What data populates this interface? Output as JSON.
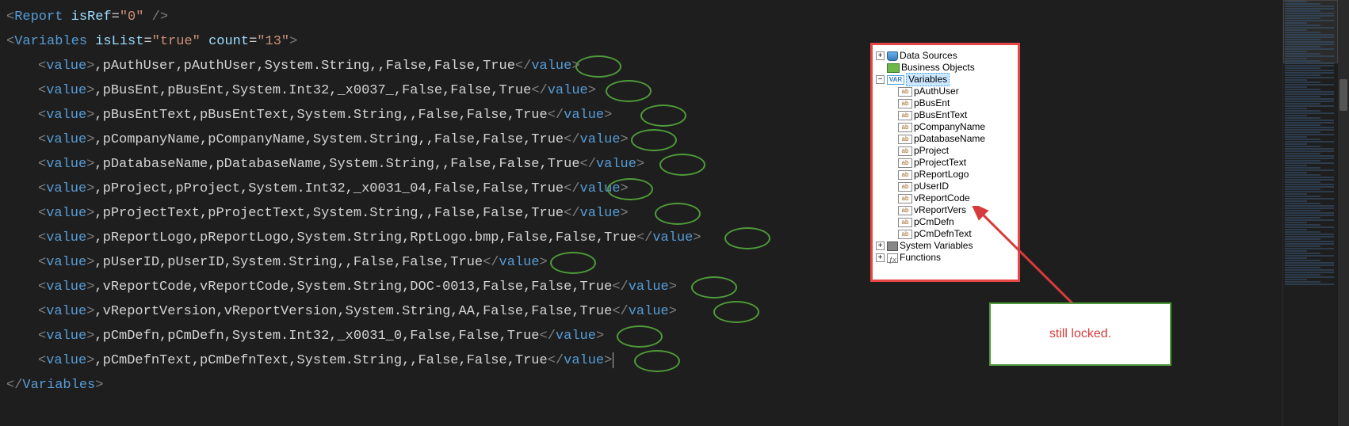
{
  "xml": {
    "reportTag": "Report",
    "reportAttr": "isRef",
    "reportAttrVal": "\"0\"",
    "variablesTag": "Variables",
    "variablesAttrs": [
      {
        "name": "isList",
        "val": "\"true\""
      },
      {
        "name": "count",
        "val": "\"13\""
      }
    ],
    "valueTag": "value",
    "lines": [
      ",pAuthUser,pAuthUser,System.String,,False,False,True",
      ",pBusEnt,pBusEnt,System.Int32,_x0037_,False,False,True",
      ",pBusEntText,pBusEntText,System.String,,False,False,True",
      ",pCompanyName,pCompanyName,System.String,,False,False,True",
      ",pDatabaseName,pDatabaseName,System.String,,False,False,True",
      ",pProject,pProject,System.Int32,_x0031_04,False,False,True",
      ",pProjectText,pProjectText,System.String,,False,False,True",
      ",pReportLogo,pReportLogo,System.String,RptLogo.bmp,False,False,True",
      ",pUserID,pUserID,System.String,,False,False,True",
      ",vReportCode,vReportCode,System.String,DOC-0013,False,False,True",
      ",vReportVersion,vReportVersion,System.String,AA,False,False,True",
      ",pCmDefn,pCmDefn,System.Int32,_x0031_0,False,False,True",
      ",pCmDefnText,pCmDefnText,System.String,,False,False,True"
    ],
    "circle_x": [
      722,
      760,
      804,
      792,
      828,
      762,
      822,
      910,
      690,
      868,
      896,
      774,
      796
    ]
  },
  "tree": {
    "dataSources": "Data Sources",
    "businessObjects": "Business Objects",
    "variables": "Variables",
    "items": [
      "pAuthUser",
      "pBusEnt",
      "pBusEntText",
      "pCompanyName",
      "pDatabaseName",
      "pProject",
      "pProjectText",
      "pReportLogo",
      "pUserID",
      "vReportCode",
      "vReportVers",
      "pCmDefn",
      "pCmDefnText"
    ],
    "systemVariables": "System Variables",
    "functions": "Functions"
  },
  "callout": "still locked.",
  "icons": {
    "plus": "+",
    "minus": "−",
    "var": "VAR",
    "field": "ab",
    "fx": "ƒx"
  }
}
